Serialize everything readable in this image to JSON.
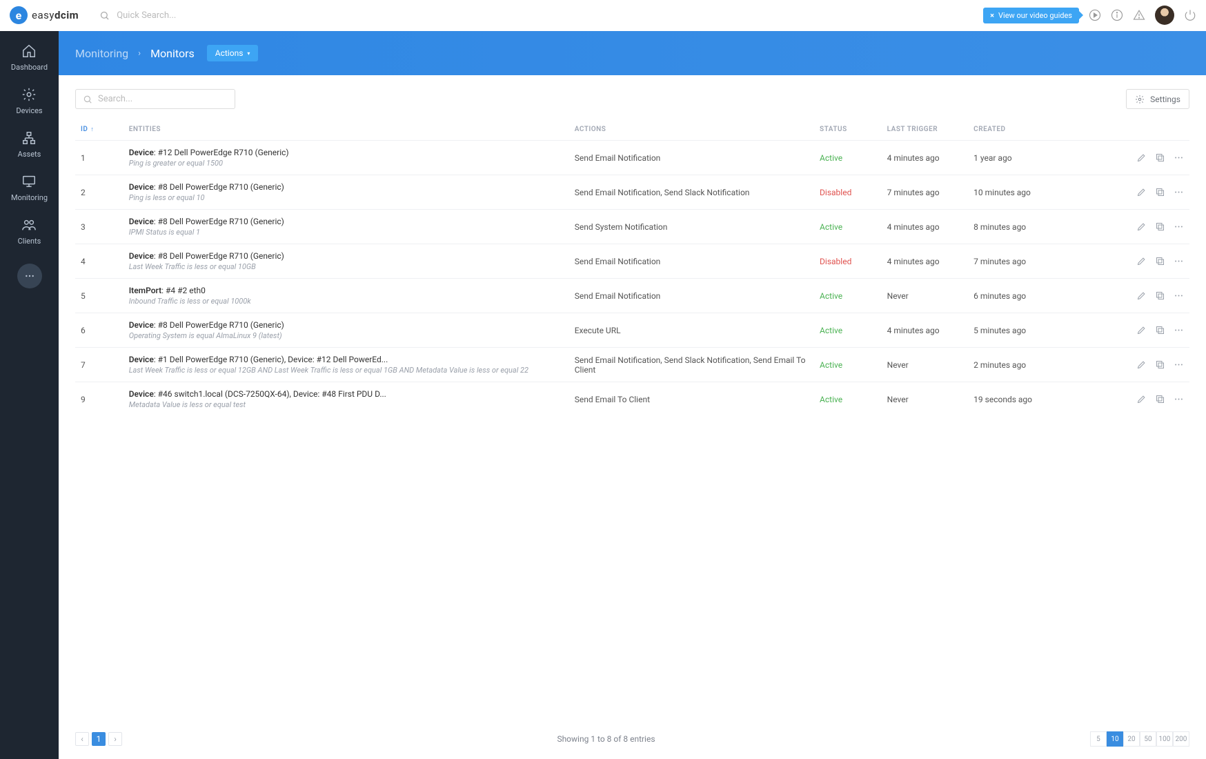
{
  "brand": {
    "name_a": "easy",
    "name_b": "dcim"
  },
  "search": {
    "quick_placeholder": "Quick Search...",
    "table_placeholder": "Search..."
  },
  "top": {
    "video_guides": "View our video guides"
  },
  "sidebar": {
    "items": [
      {
        "label": "Dashboard",
        "icon": "home"
      },
      {
        "label": "Devices",
        "icon": "gear"
      },
      {
        "label": "Assets",
        "icon": "assets"
      },
      {
        "label": "Monitoring",
        "icon": "monitor"
      },
      {
        "label": "Clients",
        "icon": "users"
      }
    ]
  },
  "page": {
    "breadcrumb_parent": "Monitoring",
    "breadcrumb_current": "Monitors",
    "actions_btn": "Actions",
    "settings": "Settings"
  },
  "columns": {
    "id": "ID",
    "entities": "ENTITIES",
    "actions": "ACTIONS",
    "status": "STATUS",
    "last_trigger": "LAST TRIGGER",
    "created": "CREATED"
  },
  "rows": [
    {
      "id": "1",
      "title_a": "Device",
      "title_b": ": #12 Dell PowerEdge R710 (Generic)",
      "sub": "Ping is greater or equal 1500",
      "actions": "Send Email Notification",
      "status": "Active",
      "status_class": "status-active",
      "trigger": "4 minutes ago",
      "created": "1 year ago"
    },
    {
      "id": "2",
      "title_a": "Device",
      "title_b": ": #8 Dell PowerEdge R710 (Generic)",
      "sub": "Ping is less or equal 10",
      "actions": "Send Email Notification, Send Slack Notification",
      "status": "Disabled",
      "status_class": "status-disabled",
      "trigger": "7 minutes ago",
      "created": "10 minutes ago"
    },
    {
      "id": "3",
      "title_a": "Device",
      "title_b": ": #8 Dell PowerEdge R710 (Generic)",
      "sub": "IPMI Status is equal 1",
      "actions": "Send System Notification",
      "status": "Active",
      "status_class": "status-active",
      "trigger": "4 minutes ago",
      "created": "8 minutes ago"
    },
    {
      "id": "4",
      "title_a": "Device",
      "title_b": ": #8 Dell PowerEdge R710 (Generic)",
      "sub": "Last Week Traffic is less or equal 10GB",
      "actions": "Send Email Notification",
      "status": "Disabled",
      "status_class": "status-disabled",
      "trigger": "4 minutes ago",
      "created": "7 minutes ago"
    },
    {
      "id": "5",
      "title_a": "ItemPort",
      "title_b": ": #4 #2 eth0",
      "sub": "Inbound Traffic is less or equal 1000k",
      "actions": "Send Email Notification",
      "status": "Active",
      "status_class": "status-active",
      "trigger": "Never",
      "created": "6 minutes ago"
    },
    {
      "id": "6",
      "title_a": "Device",
      "title_b": ": #8 Dell PowerEdge R710 (Generic)",
      "sub": "Operating System is equal AlmaLinux 9 (latest)",
      "actions": "Execute URL",
      "status": "Active",
      "status_class": "status-active",
      "trigger": "4 minutes ago",
      "created": "5 minutes ago"
    },
    {
      "id": "7",
      "title_a": "Device",
      "title_b": ": #1 Dell PowerEdge R710 (Generic), Device: #12 Dell PowerEd...",
      "sub": "Last Week Traffic is less or equal 12GB AND Last Week Traffic is less or equal 1GB AND Metadata Value is less or equal 22",
      "actions": "Send Email Notification, Send Slack Notification, Send Email To Client",
      "status": "Active",
      "status_class": "status-active",
      "trigger": "Never",
      "created": "2 minutes ago"
    },
    {
      "id": "9",
      "title_a": "Device",
      "title_b": ": #46 switch1.local (DCS-7250QX-64), Device: #48 First PDU D...",
      "sub": "Metadata Value is less or equal test",
      "actions": "Send Email To Client",
      "status": "Active",
      "status_class": "status-active",
      "trigger": "Never",
      "created": "19 seconds ago"
    }
  ],
  "footer": {
    "summary": "Showing 1 to 8 of 8 entries",
    "page": "1",
    "sizes": [
      "5",
      "10",
      "20",
      "50",
      "100",
      "200"
    ],
    "active_size": "10"
  }
}
